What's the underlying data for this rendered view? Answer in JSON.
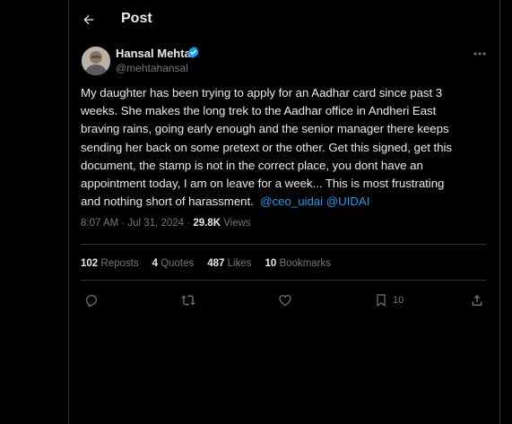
{
  "header": {
    "title": "Post"
  },
  "tweet": {
    "author_name": "Hansal Mehta",
    "author_handle": "@mehtahansal",
    "lines": [
      "My daughter has been trying to apply for an Aadhar card since past 3",
      "weeks. She makes the long trek to the Aadhar office in Andheri East",
      "braving rains, going early enough and the senior manager there keeps",
      "sending her back on some pretext or the other. Get this signed, get this",
      "document, the stamp is not in the correct place, you dont have an",
      "appointment today, I am on leave for a week... This is most frustrating",
      "and nothing short of harassment."
    ],
    "mentions": [
      "@ceo_uidai",
      "@UIDAI"
    ],
    "timestamp": "8:07 AM · Jul 31, 2024 ·",
    "views_count": "29.8K",
    "views_label": "Views"
  },
  "stats": {
    "reposts_count": "102",
    "reposts_label": "Reposts",
    "quotes_count": "4",
    "quotes_label": "Quotes",
    "likes_count": "487",
    "likes_label": "Likes",
    "bookmarks_count": "10",
    "bookmarks_label": "Bookmarks"
  },
  "actions": {
    "bookmark_count": "10"
  },
  "icons": [
    "back-arrow-icon",
    "verified-badge-icon",
    "more-icon",
    "reply-icon",
    "repost-icon",
    "like-icon",
    "bookmark-icon",
    "share-icon"
  ],
  "colors": {
    "background": "#000000",
    "text": "#e7e9ea",
    "muted": "#71767b",
    "accent": "#1d9bf0",
    "border": "#2f3336"
  }
}
